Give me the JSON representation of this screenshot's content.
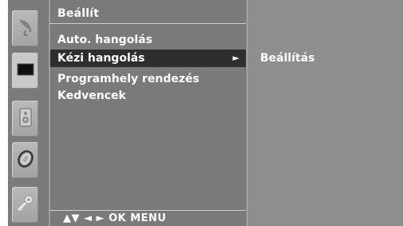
{
  "menu": {
    "title": "Beállít",
    "items": [
      {
        "label": "Auto. hangolás",
        "selected": false
      },
      {
        "label": "Kézi hangolás",
        "selected": true,
        "arrow": "►"
      },
      {
        "label": "Programhely rendezés",
        "selected": false
      },
      {
        "label": "Kedvencek",
        "selected": false
      }
    ],
    "footer": "▲▼  ◄ ►  OK  MENU"
  },
  "submenu": {
    "item": "Beállítás"
  },
  "icons": [
    {
      "name": "satellite-dish-icon",
      "active": false
    },
    {
      "name": "screen-picture-icon",
      "active": true
    },
    {
      "name": "speaker-audio-icon",
      "active": false
    },
    {
      "name": "clock-time-icon",
      "active": false
    },
    {
      "name": "key-option-icon",
      "active": false
    }
  ],
  "colors": {
    "osd_background": "#7a7a7a",
    "submenu_background": "#8e8e8e",
    "selected_row": "#2e2e2e",
    "text": "#ffffff"
  }
}
